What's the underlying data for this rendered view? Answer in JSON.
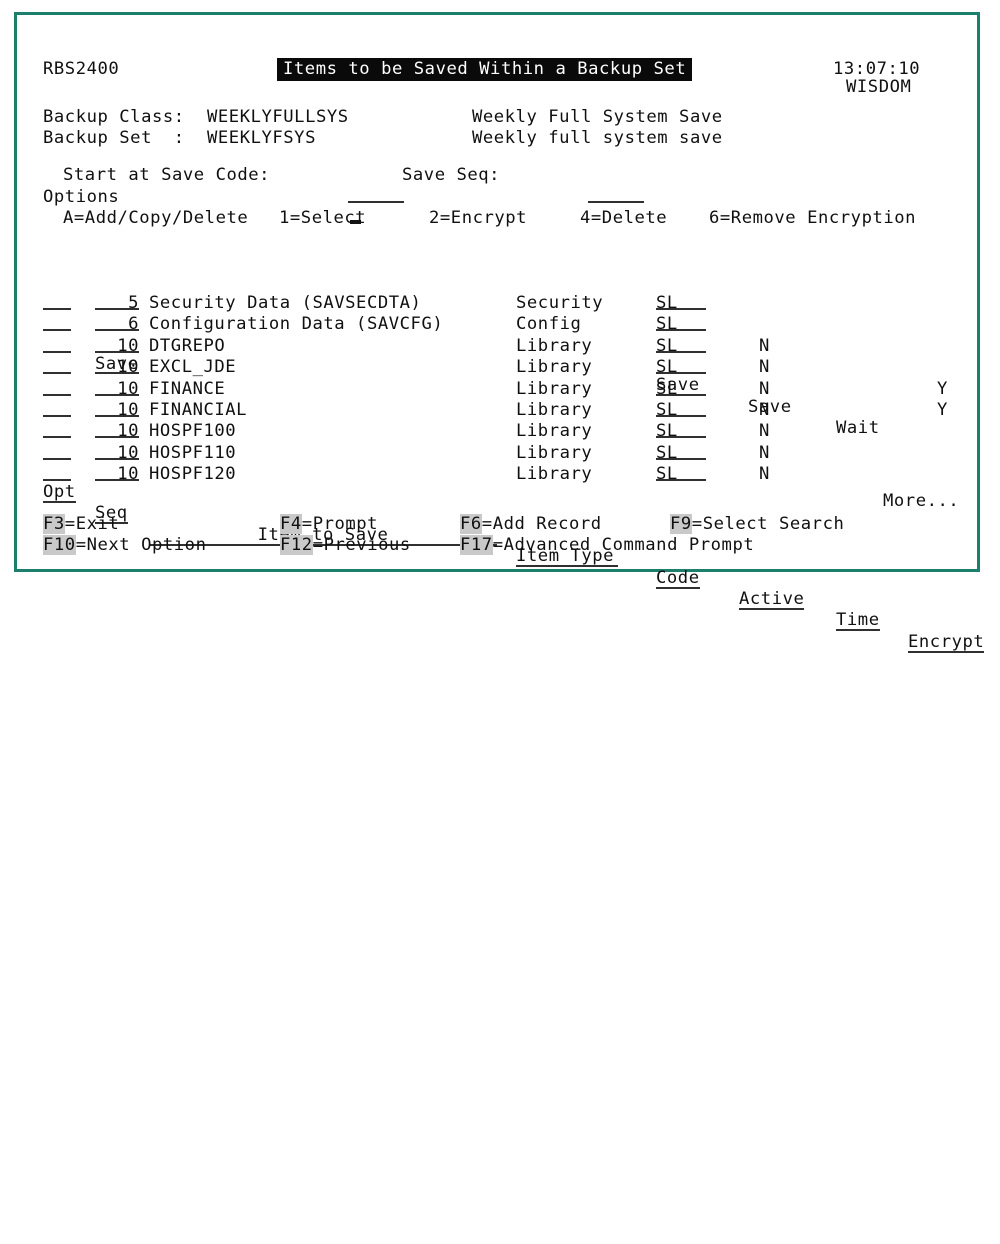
{
  "window": {
    "border_color": "#1b7f6b",
    "background": "#ffffff",
    "foreground": "#101010",
    "highlight_color": "#c9c9c9"
  },
  "header": {
    "program_id": "RBS2400",
    "title": "Items to be Saved Within a Backup Set",
    "time": "13:07:10",
    "system_name": "WISDOM"
  },
  "info": {
    "backup_class_label": "Backup Class:",
    "backup_class_value": "WEEKLYFULLSYS",
    "backup_class_desc": "Weekly Full System Save",
    "backup_set_label": "Backup Set  :",
    "backup_set_value": "WEEKLYFSYS",
    "backup_set_desc": "Weekly full system save"
  },
  "position_to": {
    "start_code_label": "Start at Save Code:",
    "start_code_value": "",
    "start_code_width": 4,
    "save_seq_label": "Save Seq:",
    "save_seq_value": "",
    "save_seq_width": 4
  },
  "options": {
    "heading": "Options",
    "items": [
      "A=Add/Copy/Delete",
      "1=Select",
      "2=Encrypt",
      "4=Delete",
      "6=Remove Encryption"
    ]
  },
  "table": {
    "headers_top": [
      "",
      "Save",
      "",
      "",
      "Save",
      "Save",
      "Wait",
      ""
    ],
    "headers": {
      "opt": "Opt",
      "seq": "Seq",
      "item": "Item to Save",
      "type": "Item Type",
      "code": "Code",
      "active": "Active",
      "wait": "Time",
      "encrypt": "Encrypt"
    },
    "headers_over": {
      "seq": "Save",
      "code": "Save",
      "active": "Save",
      "wait": "Wait"
    },
    "rows": [
      {
        "opt": "",
        "seq": "5",
        "item": "Security Data (SAVSECDTA)",
        "type": "Security",
        "code": "SL",
        "active": "",
        "wait": "",
        "encrypt": ""
      },
      {
        "opt": "",
        "seq": "6",
        "item": "Configuration Data (SAVCFG)",
        "type": "Config",
        "code": "SL",
        "active": "",
        "wait": "",
        "encrypt": ""
      },
      {
        "opt": "",
        "seq": "10",
        "item": "DTGREPO",
        "type": "Library",
        "code": "SL",
        "active": "N",
        "wait": "",
        "encrypt": ""
      },
      {
        "opt": "",
        "seq": "10",
        "item": "EXCL_JDE",
        "type": "Library",
        "code": "SL",
        "active": "N",
        "wait": "",
        "encrypt": ""
      },
      {
        "opt": "",
        "seq": "10",
        "item": "FINANCE",
        "type": "Library",
        "code": "SL",
        "active": "N",
        "wait": "",
        "encrypt": "Y"
      },
      {
        "opt": "",
        "seq": "10",
        "item": "FINANCIAL",
        "type": "Library",
        "code": "SL",
        "active": "N",
        "wait": "",
        "encrypt": "Y"
      },
      {
        "opt": "",
        "seq": "10",
        "item": "HOSPF100",
        "type": "Library",
        "code": "SL",
        "active": "N",
        "wait": "",
        "encrypt": ""
      },
      {
        "opt": "",
        "seq": "10",
        "item": "HOSPF110",
        "type": "Library",
        "code": "SL",
        "active": "N",
        "wait": "",
        "encrypt": ""
      },
      {
        "opt": "",
        "seq": "10",
        "item": "HOSPF120",
        "type": "Library",
        "code": "SL",
        "active": "N",
        "wait": "",
        "encrypt": ""
      }
    ],
    "more_indicator": "More..."
  },
  "function_keys": {
    "row1": [
      {
        "key": "F3",
        "label": "=Exit"
      },
      {
        "key": "F4",
        "label": "=Prompt"
      },
      {
        "key": "F6",
        "label": "=Add Record"
      },
      {
        "key": "F9",
        "label": "=Select Search"
      }
    ],
    "row2": [
      {
        "key": "F10",
        "label": "=Next Option"
      },
      {
        "key": "F12",
        "label": "=Previous"
      },
      {
        "key": "F17",
        "label": "=Advanced Command Prompt"
      }
    ]
  }
}
